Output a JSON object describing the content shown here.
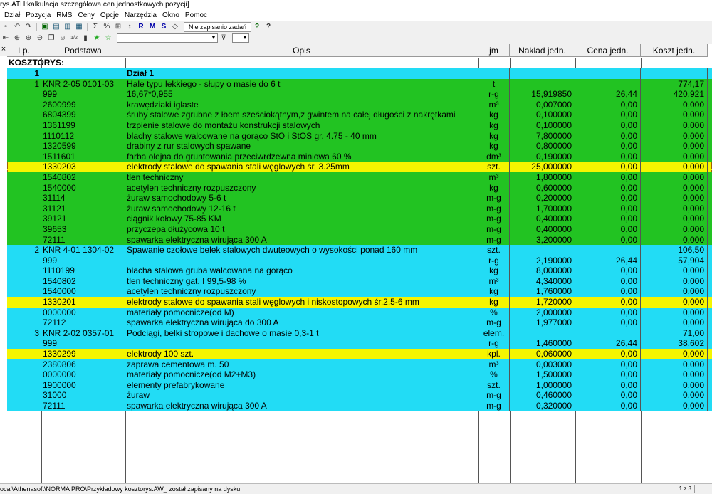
{
  "window": {
    "title": "rys.ATH:kalkulacja szczegółowa cen jednostkowych pozycji]"
  },
  "menu": [
    "Dział",
    "Pozycja",
    "RMS",
    "Ceny",
    "Opcje",
    "Narzędzia",
    "Okno",
    "Pomoc"
  ],
  "toolbar": {
    "save_status": "Nie zapisanio zadań"
  },
  "columns": {
    "lp": "Lp.",
    "podstawa": "Podstawa",
    "opis": "Opis",
    "jm": "jm",
    "naklad": "Nakład jedn.",
    "cena": "Cena jedn.",
    "koszt": "Koszt jedn."
  },
  "section_title": "KOSZTORYS:",
  "rows": [
    {
      "lp": "1",
      "podstawa": "",
      "opis": "Dział 1",
      "jm": "",
      "naklad": "",
      "cena": "",
      "koszt": "",
      "color": "cyan",
      "bold": true
    },
    {
      "lp": "1",
      "podstawa": "KNR 2-05 0101-03",
      "opis": "Hale typu lekkiego - słupy o masie do 6 t",
      "jm": "t",
      "naklad": "",
      "cena": "",
      "koszt": "774,17",
      "color": "green"
    },
    {
      "lp": "",
      "podstawa": "999",
      "opis": "16,67*0,955=",
      "jm": "r-g",
      "naklad": "15,919850",
      "cena": "26,44",
      "koszt": "420,921",
      "color": "green"
    },
    {
      "lp": "",
      "podstawa": "2600999",
      "opis": "krawędziaki iglaste",
      "jm": "m³",
      "naklad": "0,007000",
      "cena": "0,00",
      "koszt": "0,000",
      "color": "green"
    },
    {
      "lp": "",
      "podstawa": "6804399",
      "opis": "śruby stalowe zgrubne z łbem sześciokątnym,z gwintem na całej długości z nakrętkami",
      "jm": "kg",
      "naklad": "0,100000",
      "cena": "0,00",
      "koszt": "0,000",
      "color": "green"
    },
    {
      "lp": "",
      "podstawa": "1361199",
      "opis": "trzpienie stalowe do montażu konstrukcji stalowych",
      "jm": "kg",
      "naklad": "0,100000",
      "cena": "0,00",
      "koszt": "0,000",
      "color": "green"
    },
    {
      "lp": "",
      "podstawa": "1110112",
      "opis": "blachy stalowe walcowane na gorąco StO i StOS gr. 4.75 - 40 mm",
      "jm": "kg",
      "naklad": "7,800000",
      "cena": "0,00",
      "koszt": "0,000",
      "color": "green"
    },
    {
      "lp": "",
      "podstawa": "1320599",
      "opis": "drabiny z rur stalowych spawane",
      "jm": "kg",
      "naklad": "0,800000",
      "cena": "0,00",
      "koszt": "0,000",
      "color": "green"
    },
    {
      "lp": "",
      "podstawa": "1511601",
      "opis": "farba olejna do gruntowania przeciwrdzewna miniowa 60 %",
      "jm": "dm³",
      "naklad": "0,190000",
      "cena": "0,00",
      "koszt": "0,000",
      "color": "green"
    },
    {
      "lp": "",
      "podstawa": "1330203",
      "opis": "elektrody stalowe do spawania stali węglowych śr. 3.25mm",
      "jm": "szt.",
      "naklad": "25,000000",
      "cena": "0,00",
      "koszt": "0,000",
      "color": "yellow",
      "highlight": true
    },
    {
      "lp": "",
      "podstawa": "1540802",
      "opis": "tlen techniczny",
      "jm": "m³",
      "naklad": "1,800000",
      "cena": "0,00",
      "koszt": "0,000",
      "color": "green"
    },
    {
      "lp": "",
      "podstawa": "1540000",
      "opis": "acetylen techniczny rozpuszczony",
      "jm": "kg",
      "naklad": "0,600000",
      "cena": "0,00",
      "koszt": "0,000",
      "color": "green"
    },
    {
      "lp": "",
      "podstawa": "31114",
      "opis": "żuraw samochodowy 5-6 t",
      "jm": "m-g",
      "naklad": "0,200000",
      "cena": "0,00",
      "koszt": "0,000",
      "color": "green"
    },
    {
      "lp": "",
      "podstawa": "31121",
      "opis": "żuraw samochodowy 12-16 t",
      "jm": "m-g",
      "naklad": "1,700000",
      "cena": "0,00",
      "koszt": "0,000",
      "color": "green"
    },
    {
      "lp": "",
      "podstawa": "39121",
      "opis": "ciągnik kołowy 75-85 KM",
      "jm": "m-g",
      "naklad": "0,400000",
      "cena": "0,00",
      "koszt": "0,000",
      "color": "green"
    },
    {
      "lp": "",
      "podstawa": "39653",
      "opis": "przyczepa dłużycowa 10 t",
      "jm": "m-g",
      "naklad": "0,400000",
      "cena": "0,00",
      "koszt": "0,000",
      "color": "green"
    },
    {
      "lp": "",
      "podstawa": "72111",
      "opis": "spawarka elektryczna wirująca 300 A",
      "jm": "m-g",
      "naklad": "3,200000",
      "cena": "0,00",
      "koszt": "0,000",
      "color": "green"
    },
    {
      "lp": "2",
      "podstawa": "KNR 4-01 1304-02",
      "opis": "Spawanie czołowe belek stalowych dwuteowych o wysokości ponad 160 mm",
      "jm": "szt.",
      "naklad": "",
      "cena": "",
      "koszt": "106,50",
      "color": "cyan"
    },
    {
      "lp": "",
      "podstawa": "999",
      "opis": "",
      "jm": "r-g",
      "naklad": "2,190000",
      "cena": "26,44",
      "koszt": "57,904",
      "color": "cyan"
    },
    {
      "lp": "",
      "podstawa": "1110199",
      "opis": "blacha stalowa gruba walcowana na gorąco",
      "jm": "kg",
      "naklad": "8,000000",
      "cena": "0,00",
      "koszt": "0,000",
      "color": "cyan"
    },
    {
      "lp": "",
      "podstawa": "1540802",
      "opis": "tlen techniczny gat. I 99,5-98 %",
      "jm": "m³",
      "naklad": "4,340000",
      "cena": "0,00",
      "koszt": "0,000",
      "color": "cyan"
    },
    {
      "lp": "",
      "podstawa": "1540000",
      "opis": "acetylen techniczny rozpuszczony",
      "jm": "kg",
      "naklad": "1,760000",
      "cena": "0,00",
      "koszt": "0,000",
      "color": "cyan"
    },
    {
      "lp": "",
      "podstawa": "1330201",
      "opis": "elektrody stalowe do spawania stali węglowych i niskostopowych śr.2.5-6 mm",
      "jm": "kg",
      "naklad": "1,720000",
      "cena": "0,00",
      "koszt": "0,000",
      "color": "yellow"
    },
    {
      "lp": "",
      "podstawa": "0000000",
      "opis": "materiały pomocnicze(od M)",
      "jm": "%",
      "naklad": "2,000000",
      "cena": "0,00",
      "koszt": "0,000",
      "color": "cyan"
    },
    {
      "lp": "",
      "podstawa": "72112",
      "opis": "spawarka elektryczna wirująca do 300 A",
      "jm": "m-g",
      "naklad": "1,977000",
      "cena": "0,00",
      "koszt": "0,000",
      "color": "cyan"
    },
    {
      "lp": "3",
      "podstawa": "KNR 2-02 0357-01",
      "opis": "Podciągi, belki stropowe i dachowe o masie 0,3-1 t",
      "jm": "elem.",
      "naklad": "",
      "cena": "",
      "koszt": "71,00",
      "color": "cyan"
    },
    {
      "lp": "",
      "podstawa": "999",
      "opis": "",
      "jm": "r-g",
      "naklad": "1,460000",
      "cena": "26,44",
      "koszt": "38,602",
      "color": "cyan"
    },
    {
      "lp": "",
      "podstawa": "1330299",
      "opis": "elektrody 100 szt.",
      "jm": "kpl.",
      "naklad": "0,060000",
      "cena": "0,00",
      "koszt": "0,000",
      "color": "yellow"
    },
    {
      "lp": "",
      "podstawa": "2380806",
      "opis": "zaprawa cementowa m. 50",
      "jm": "m³",
      "naklad": "0,003000",
      "cena": "0,00",
      "koszt": "0,000",
      "color": "cyan"
    },
    {
      "lp": "",
      "podstawa": "0000000",
      "opis": "materiały pomocnicze(od M2+M3)",
      "jm": "%",
      "naklad": "1,500000",
      "cena": "0,00",
      "koszt": "0,000",
      "color": "cyan"
    },
    {
      "lp": "",
      "podstawa": "1900000",
      "opis": "elementy prefabrykowane",
      "jm": "szt.",
      "naklad": "1,000000",
      "cena": "0,00",
      "koszt": "0,000",
      "color": "cyan"
    },
    {
      "lp": "",
      "podstawa": "31000",
      "opis": "żuraw",
      "jm": "m-g",
      "naklad": "0,460000",
      "cena": "0,00",
      "koszt": "0,000",
      "color": "cyan"
    },
    {
      "lp": "",
      "podstawa": "72111",
      "opis": "spawarka elektryczna wirująca 300 A",
      "jm": "m-g",
      "naklad": "0,320000",
      "cena": "0,00",
      "koszt": "0,000",
      "color": "cyan"
    }
  ],
  "status": {
    "message": "ocal\\Athenasoft\\NORMA PRO\\Przykładowy kosztorys.AW_ został zapisany na dysku",
    "pages": "1 z 3"
  }
}
